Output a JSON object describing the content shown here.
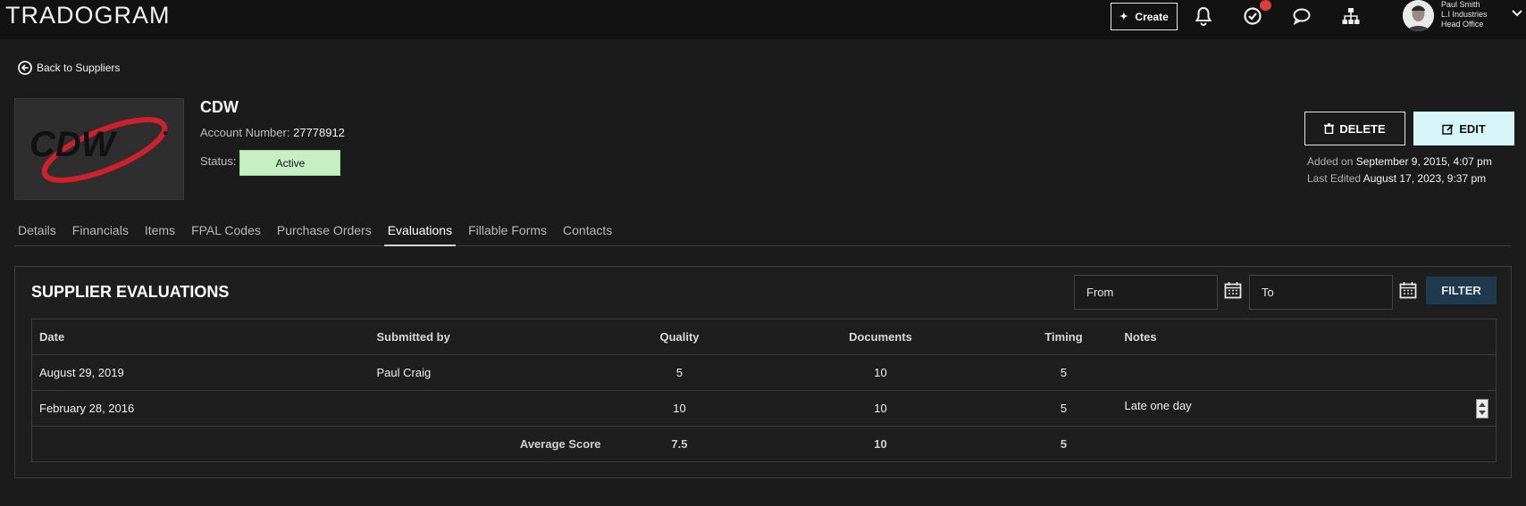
{
  "app": {
    "logo": "TRADOGRAM"
  },
  "topbar": {
    "create_label": "Create",
    "user": {
      "name": "Paul Smith",
      "company": "L.I Industries",
      "office": "Head Office"
    }
  },
  "back_link": "Back to Suppliers",
  "supplier": {
    "name": "CDW",
    "logo_text": "CDW",
    "account_label": "Account Number:",
    "account_number": "27778912",
    "status_label": "Status:",
    "status": "Active",
    "added_label": "Added on",
    "added": "September 9, 2015, 4:07 pm",
    "edited_label": "Last Edited",
    "edited": "August 17, 2023, 9:37 pm"
  },
  "actions": {
    "delete_label": "DELETE",
    "edit_label": "EDIT"
  },
  "tabs": [
    {
      "label": "Details"
    },
    {
      "label": "Financials"
    },
    {
      "label": "Items"
    },
    {
      "label": "FPAL Codes"
    },
    {
      "label": "Purchase Orders"
    },
    {
      "label": "Evaluations",
      "active": true
    },
    {
      "label": "Fillable Forms"
    },
    {
      "label": "Contacts"
    }
  ],
  "evaluations": {
    "title": "SUPPLIER EVALUATIONS",
    "from_placeholder": "From",
    "to_placeholder": "To",
    "filter_label": "FILTER",
    "columns": [
      "Date",
      "Submitted by",
      "Quality",
      "Documents",
      "Timing",
      "Notes"
    ],
    "rows": [
      {
        "date": "August 29, 2019",
        "submitted_by": "Paul Craig",
        "quality": "5",
        "documents": "10",
        "timing": "5",
        "notes": ""
      },
      {
        "date": "February 28, 2016",
        "submitted_by": "",
        "quality": "10",
        "documents": "10",
        "timing": "5",
        "notes": "Late one day"
      }
    ],
    "average": {
      "label": "Average Score",
      "quality": "7.5",
      "documents": "10",
      "timing": "5"
    }
  },
  "colors": {
    "accent": "#d8f6f9",
    "status_bg": "#c6f0c4",
    "badge": "#e03a3a",
    "filter_bg": "#1f3a4f"
  }
}
